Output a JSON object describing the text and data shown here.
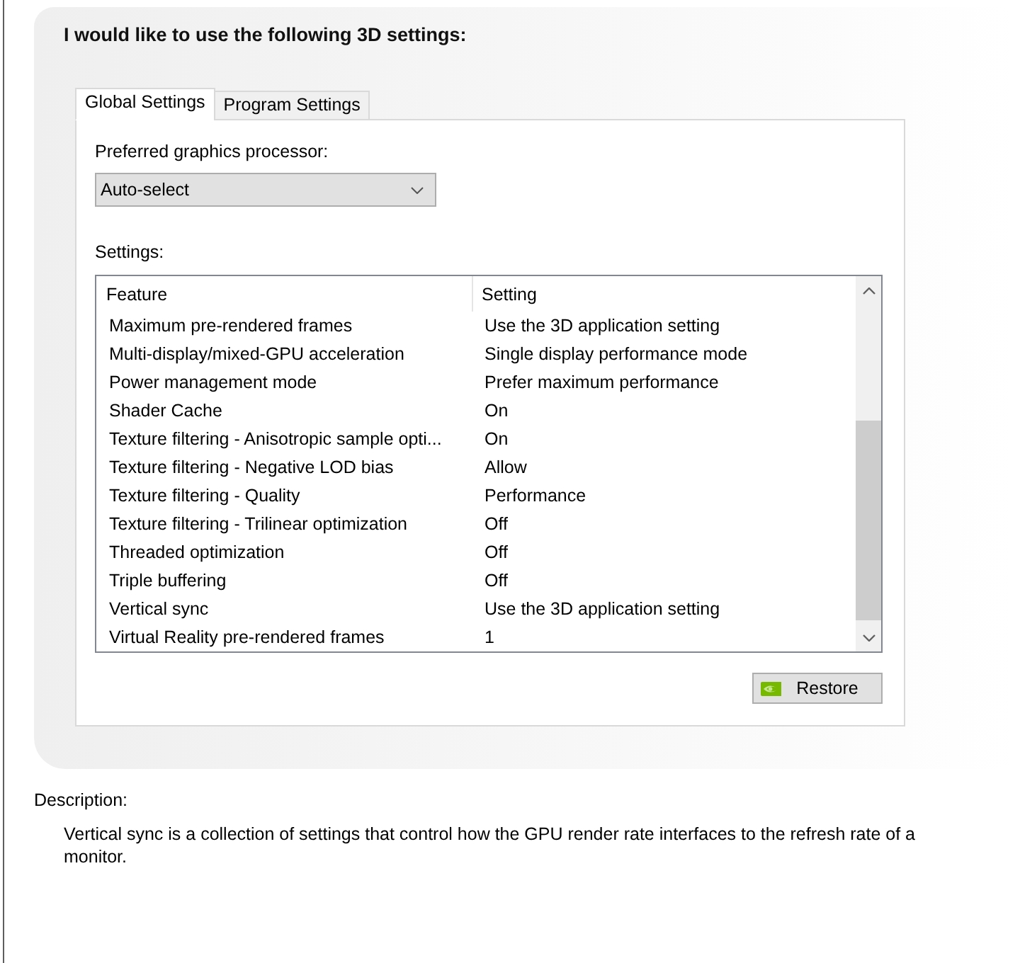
{
  "heading": "I would like to use the following 3D settings:",
  "tabs": [
    {
      "label": "Global Settings",
      "selected": true
    },
    {
      "label": "Program Settings",
      "selected": false
    }
  ],
  "global_settings": {
    "gpu_label": "Preferred graphics processor:",
    "gpu_dropdown": {
      "value": "Auto-select"
    },
    "settings_label": "Settings:",
    "columns": [
      "Feature",
      "Setting"
    ],
    "rows": [
      {
        "feature": "Maximum pre-rendered frames",
        "setting": "Use the 3D application setting",
        "selected": false
      },
      {
        "feature": "Multi-display/mixed-GPU acceleration",
        "setting": "Single display performance mode",
        "selected": false
      },
      {
        "feature": "Power management mode",
        "setting": "Prefer maximum performance",
        "selected": false
      },
      {
        "feature": "Shader Cache",
        "setting": "On",
        "selected": false
      },
      {
        "feature": "Texture filtering - Anisotropic sample opti...",
        "setting": "On",
        "selected": false
      },
      {
        "feature": "Texture filtering - Negative LOD bias",
        "setting": "Allow",
        "selected": false
      },
      {
        "feature": "Texture filtering - Quality",
        "setting": "Performance",
        "selected": false
      },
      {
        "feature": "Texture filtering - Trilinear optimization",
        "setting": "Off",
        "selected": false
      },
      {
        "feature": "Threaded optimization",
        "setting": "Off",
        "selected": false
      },
      {
        "feature": "Triple buffering",
        "setting": "Off",
        "selected": false
      },
      {
        "feature": "Vertical sync",
        "setting": "Use the 3D application setting",
        "selected": false
      },
      {
        "feature": "Virtual Reality pre-rendered frames",
        "setting": "1",
        "selected": false
      }
    ],
    "restore_button": {
      "label": "Restore"
    }
  },
  "description": {
    "label": "Description:",
    "text": "Vertical sync is a collection of settings that control how the GPU render rate interfaces to the refresh rate of a monitor."
  }
}
